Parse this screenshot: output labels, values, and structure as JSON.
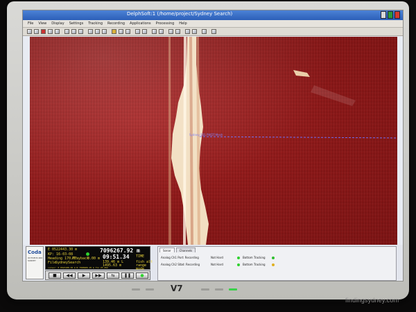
{
  "window": {
    "title": "DelphSoft:1 (/home/project/Sydney Search)"
  },
  "menu": [
    "File",
    "View",
    "Display",
    "Settings",
    "Tracking",
    "Recording",
    "Applications",
    "Processing",
    "Help"
  ],
  "sonar": {
    "track_label": "Sydney SSS PWDT-Mesh"
  },
  "logo": {
    "word": "Coda",
    "sub": "OCTOPUS 460 SURVEY"
  },
  "navigation": {
    "easting": "E 0522443.30 m",
    "northing": "7096267.92 m",
    "kp": "KP: 16-03-08",
    "heading_label": "Heading 170.0°",
    "playback_label": "Playback",
    "playback_value": "0.00 m",
    "file_label": "File",
    "file_value": "SydneySearch",
    "clock": "09:51.34",
    "time_label": "TIME",
    "fish_alt_label": "fish alt",
    "fish_alt_value": "139.46 m L",
    "range_value": "1495.63 m",
    "range_label": "range",
    "cursor_line": "cursor: E 0523180.30 m N 7096906.25 m fix 23.452",
    "extra_value": "23.452",
    "mode_label": "mode"
  },
  "playback_buttons": [
    "■",
    "◀◀",
    "▶",
    "▶▶",
    "⇆",
    "❚❚",
    "●"
  ],
  "channels": {
    "tabs": [
      "Sonar",
      "Channels"
    ],
    "rows": [
      {
        "name": "Analog Ch1 Port: Recording",
        "status": "Not Hard",
        "tracking": "Bottom Tracking",
        "tracking_color": "#2fbf2f"
      },
      {
        "name": "Analog Ch2 Stbd: Recording",
        "status": "Not Hard",
        "tracking": "Bottom Tracking",
        "tracking_color": "#e0b020"
      }
    ]
  },
  "bezel": {
    "logo": "V7"
  },
  "watermark": "findingsydney.com",
  "colors": {
    "sonar_background": "#8e1616",
    "nadir_bright": "#f4e2c4",
    "track_line": "#6f6cf0",
    "led_green": "#2fd12f",
    "led_amber": "#e0b020"
  }
}
